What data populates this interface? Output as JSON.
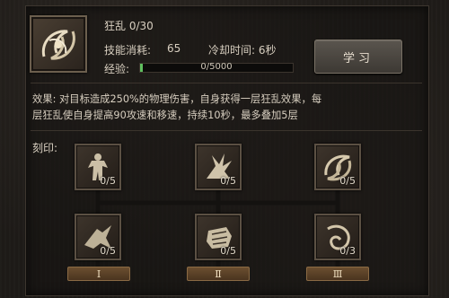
{
  "skill": {
    "name_level": "狂乱 0/30",
    "cost_label": "技能消耗:",
    "cost_value": "65",
    "cooldown": "冷却时间: 6秒",
    "xp_label": "经验:",
    "xp_text": "0/5000",
    "xp_progress": 0.02,
    "icon": "swirling-blade-icon"
  },
  "learn_button": "学习",
  "effect": {
    "line1": "效果:  对目标造成250%的物理伤害，自身获得一层狂乱效果，每",
    "line2": "层狂乱使自身提高90攻速和移速，持续10秒，最多叠加5层"
  },
  "engrave": {
    "label": "刻印:",
    "runes": [
      {
        "icon": "warrior-pose-icon",
        "count": "0/5"
      },
      {
        "icon": "claw-burst-icon",
        "count": "0/5"
      },
      {
        "icon": "swirl-blade-icon",
        "count": "0/5"
      },
      {
        "icon": "dash-strike-icon",
        "count": "0/5"
      },
      {
        "icon": "fist-icon",
        "count": "0/5"
      },
      {
        "icon": "vortex-icon",
        "count": "0/3"
      }
    ],
    "tiers": [
      "Ⅰ",
      "Ⅱ",
      "Ⅲ"
    ]
  }
}
